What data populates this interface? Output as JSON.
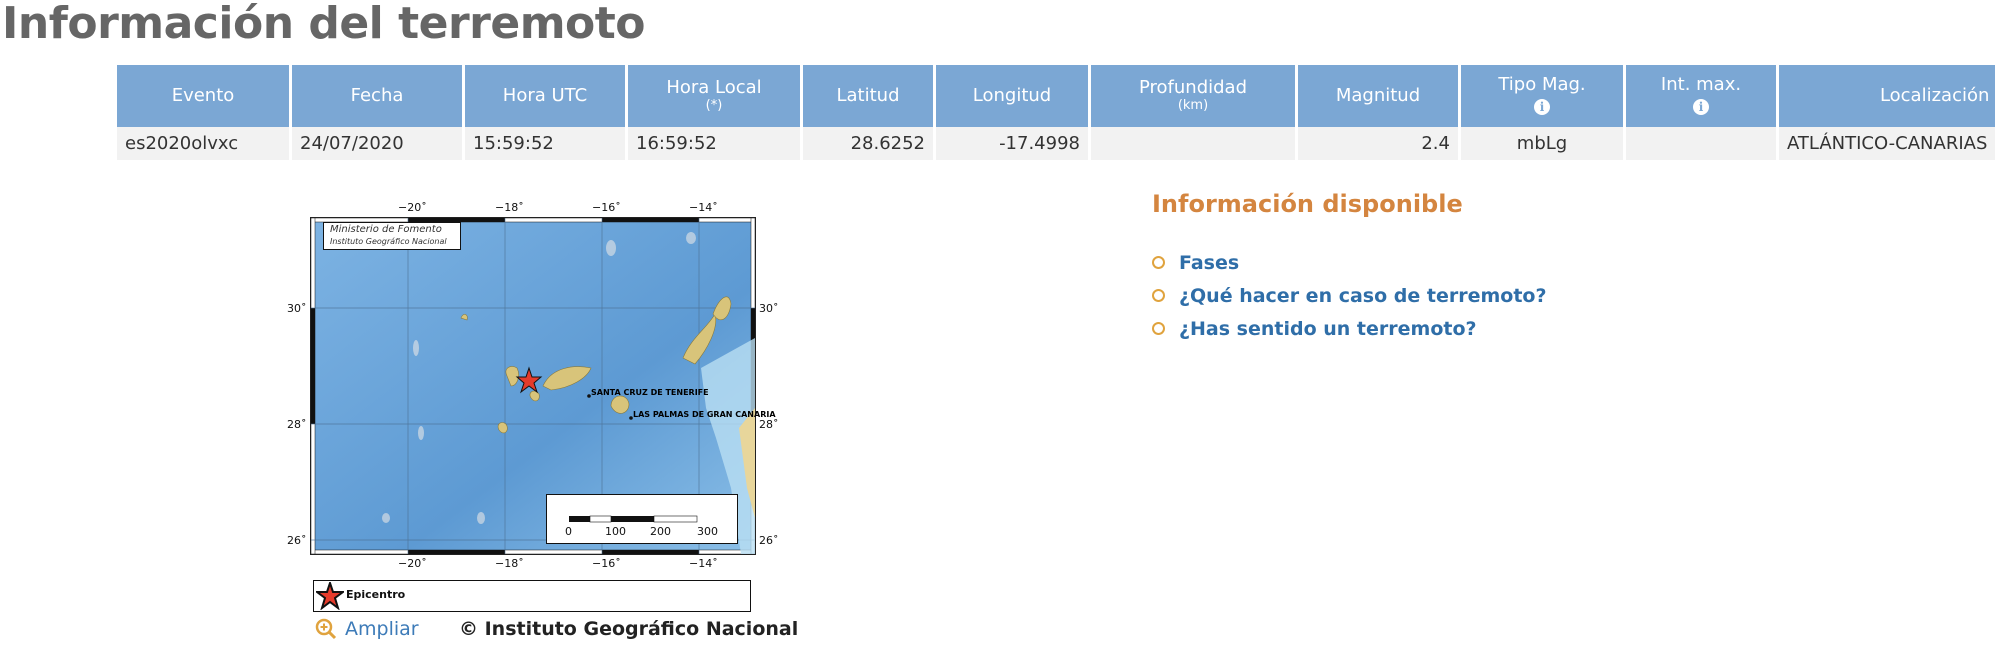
{
  "page_title": "Información del terremoto",
  "table": {
    "headers": [
      {
        "label": "Evento",
        "sub": ""
      },
      {
        "label": "Fecha",
        "sub": ""
      },
      {
        "label": "Hora UTC",
        "sub": ""
      },
      {
        "label": "Hora Local",
        "sub": "(*)"
      },
      {
        "label": "Latitud",
        "sub": ""
      },
      {
        "label": "Longitud",
        "sub": ""
      },
      {
        "label": "Profundidad",
        "sub": "(km)"
      },
      {
        "label": "Magnitud",
        "sub": ""
      },
      {
        "label": "Tipo Mag.",
        "sub": ""
      },
      {
        "label": "Int. max.",
        "sub": ""
      },
      {
        "label": "Localización",
        "sub": ""
      }
    ],
    "row": {
      "evento": "es2020olvxc",
      "fecha": "24/07/2020",
      "hora_utc": "15:59:52",
      "hora_local": "16:59:52",
      "latitud": "28.6252",
      "longitud": "-17.4998",
      "profundidad": "",
      "magnitud": "2.4",
      "tipo_mag": "mbLg",
      "int_max": "",
      "localizacion": "ATLÁNTICO-CANARIAS"
    }
  },
  "map": {
    "x_ticks": [
      "−20˚",
      "−18˚",
      "−16˚",
      "−14˚"
    ],
    "y_ticks": [
      "30˚",
      "28˚",
      "26˚"
    ],
    "credit_line1": "Ministerio de Fomento",
    "credit_line2": "Instituto Geográfico Nacional",
    "city1": "SANTA CRUZ DE TENERIFE",
    "city2": "LAS PALMAS DE GRAN CANARIA",
    "scale_labels": [
      "0",
      "100",
      "200",
      "300"
    ],
    "legend_label": "Epicentro",
    "ampliar": "Ampliar",
    "copyright": "© Instituto Geográfico Nacional",
    "colors": {
      "ocean": "#6ea6d9",
      "land": "#d8c47a"
    }
  },
  "info": {
    "title": "Información disponible",
    "links": [
      "Fases",
      "¿Qué hacer en caso de terremoto?",
      "¿Has sentido un terremoto?"
    ]
  }
}
